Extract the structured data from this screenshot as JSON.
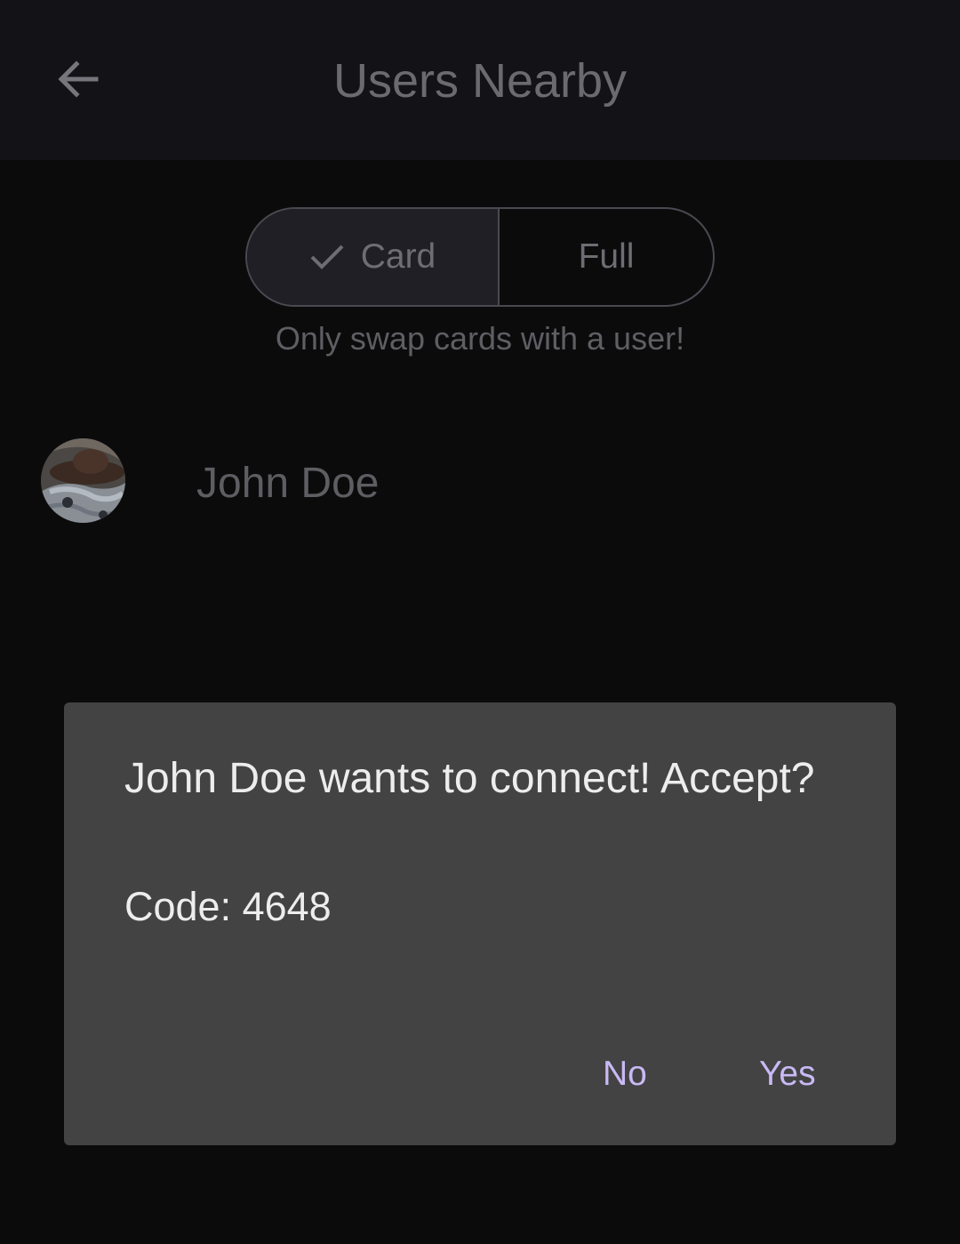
{
  "app_bar": {
    "title": "Users Nearby",
    "back_icon": "arrow-back-icon"
  },
  "mode_toggle": {
    "options": [
      {
        "label": "Card",
        "selected": true,
        "icon": "check-icon"
      },
      {
        "label": "Full",
        "selected": false
      }
    ],
    "hint": "Only swap cards with a user!"
  },
  "users": [
    {
      "name": "John Doe",
      "avatar": "avatar-photo"
    }
  ],
  "dialog": {
    "message": "John Doe wants to connect! Accept?",
    "code": "Code: 4648",
    "no_label": "No",
    "yes_label": "Yes"
  },
  "colors": {
    "background": "#0b0b0c",
    "app_bar": "#131217",
    "dialog": "#434343",
    "dialog_text": "#ededed",
    "accent": "#c9b9f5"
  }
}
